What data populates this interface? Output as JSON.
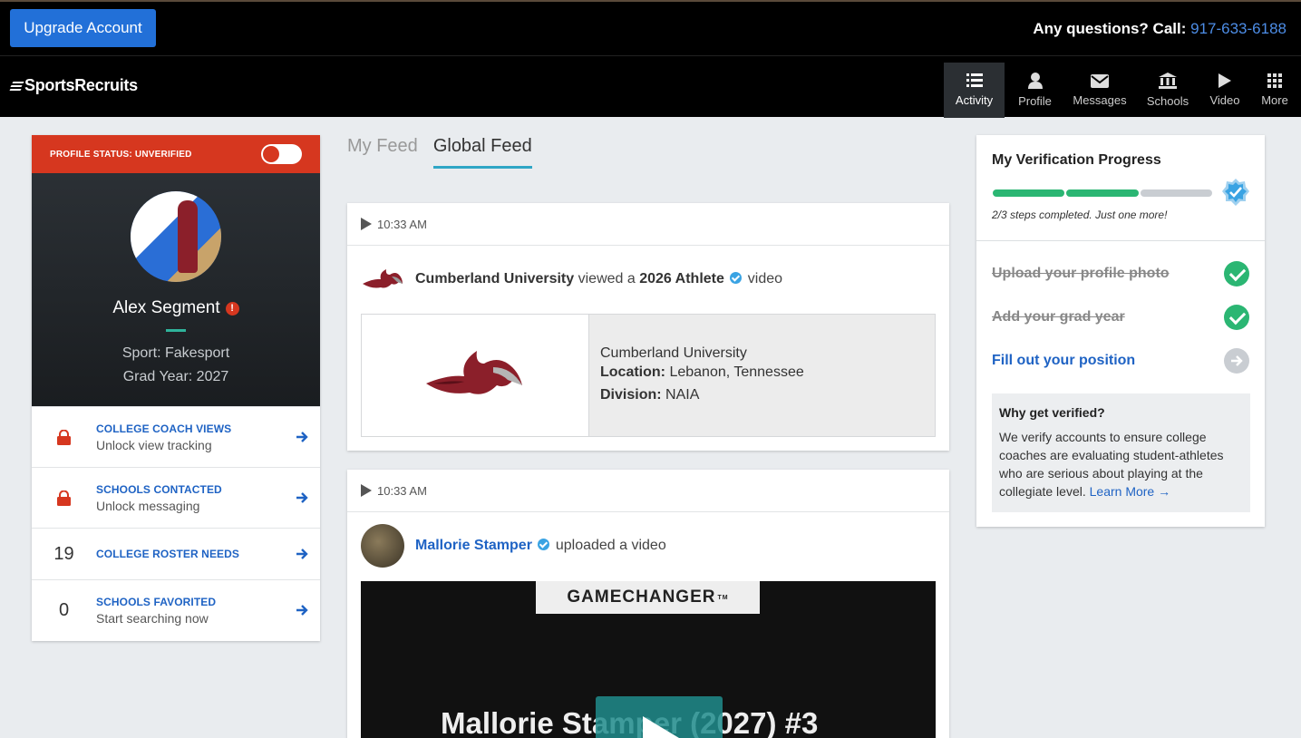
{
  "topbar": {
    "upgrade_label": "Upgrade Account",
    "questions_label": "Any questions? Call:",
    "phone": "917-633-6188"
  },
  "brand": {
    "name": "SportsRecruits"
  },
  "nav": {
    "items": [
      {
        "label": "Activity",
        "icon": "list-icon",
        "active": true
      },
      {
        "label": "Profile",
        "icon": "person-icon"
      },
      {
        "label": "Messages",
        "icon": "envelope-icon"
      },
      {
        "label": "Schools",
        "icon": "building-icon"
      },
      {
        "label": "Video",
        "icon": "play-icon"
      },
      {
        "label": "More",
        "icon": "grid-icon"
      }
    ]
  },
  "profile": {
    "status_label": "PROFILE STATUS: UNVERIFIED",
    "name": "Alex Segment",
    "sport": "Sport: Fakesport",
    "grad_year": "Grad Year: 2027",
    "stats": [
      {
        "left": "",
        "icon": "lock-icon",
        "title": "COLLEGE COACH VIEWS",
        "sub": "Unlock view tracking"
      },
      {
        "left": "",
        "icon": "lock-icon",
        "title": "SCHOOLS CONTACTED",
        "sub": "Unlock messaging"
      },
      {
        "left": "19",
        "title": "COLLEGE ROSTER NEEDS",
        "sub": ""
      },
      {
        "left": "0",
        "title": "SCHOOLS FAVORITED",
        "sub": "Start searching now"
      }
    ]
  },
  "feed": {
    "tabs": [
      {
        "label": "My Feed",
        "active": false
      },
      {
        "label": "Global Feed",
        "active": true
      }
    ],
    "cards": [
      {
        "time": "10:33 AM",
        "actor": "Cumberland University",
        "verb": "viewed a",
        "object": "2026 Athlete",
        "suffix": "video",
        "school": {
          "name": "Cumberland University",
          "location_label": "Location:",
          "location": "Lebanon, Tennessee",
          "division_label": "Division:",
          "division": "NAIA"
        }
      },
      {
        "time": "10:33 AM",
        "actor": "Mallorie Stamper",
        "verb": "uploaded a video",
        "video": {
          "banner": "GAMECHANGER",
          "trademark": "TM",
          "title": "Mallorie Stamper (2027) #3"
        }
      }
    ]
  },
  "verification": {
    "title": "My Verification Progress",
    "steps_done": 2,
    "steps_total": 3,
    "progress_text": "2/3 steps completed. Just one more!",
    "steps": [
      {
        "label": "Upload your profile photo",
        "done": true
      },
      {
        "label": "Add your grad year",
        "done": true
      },
      {
        "label": "Fill out your position",
        "done": false
      }
    ],
    "why_title": "Why get verified?",
    "why_text": "We verify accounts to ensure college coaches are evaluating student-athletes who are serious about playing at the collegiate level.",
    "why_link": "Learn More →"
  },
  "colors": {
    "accent_blue": "#2270d8",
    "status_red": "#d6371f",
    "success_green": "#2bb673",
    "tab_underline": "#2fa6c6"
  }
}
